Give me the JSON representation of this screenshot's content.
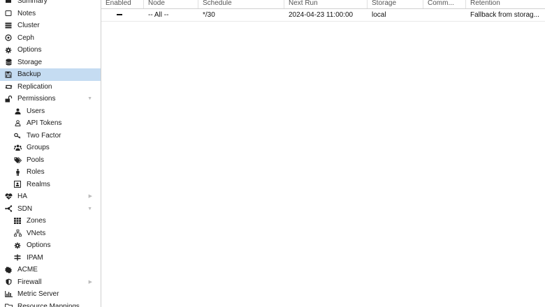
{
  "sidebar": {
    "items": [
      {
        "label": "Summary",
        "icon": "summary-icon",
        "level": 0
      },
      {
        "label": "Notes",
        "icon": "notes-icon",
        "level": 0
      },
      {
        "label": "Cluster",
        "icon": "server-icon",
        "level": 0
      },
      {
        "label": "Ceph",
        "icon": "ceph-icon",
        "level": 0
      },
      {
        "label": "Options",
        "icon": "gear-icon",
        "level": 0
      },
      {
        "label": "Storage",
        "icon": "database-icon",
        "level": 0
      },
      {
        "label": "Backup",
        "icon": "floppy-icon",
        "level": 0,
        "selected": true
      },
      {
        "label": "Replication",
        "icon": "retweet-icon",
        "level": 0
      },
      {
        "label": "Permissions",
        "icon": "unlock-icon",
        "level": 0,
        "caret": "down"
      },
      {
        "label": "Users",
        "icon": "user-icon",
        "level": 1
      },
      {
        "label": "API Tokens",
        "icon": "user-outline-icon",
        "level": 1
      },
      {
        "label": "Two Factor",
        "icon": "key-icon",
        "level": 1
      },
      {
        "label": "Groups",
        "icon": "users-icon",
        "level": 1
      },
      {
        "label": "Pools",
        "icon": "tags-icon",
        "level": 1
      },
      {
        "label": "Roles",
        "icon": "male-icon",
        "level": 1
      },
      {
        "label": "Realms",
        "icon": "address-book-icon",
        "level": 1
      },
      {
        "label": "HA",
        "icon": "heartbeat-icon",
        "level": 0,
        "caret": "right"
      },
      {
        "label": "SDN",
        "icon": "sdn-icon",
        "level": 0,
        "caret": "down"
      },
      {
        "label": "Zones",
        "icon": "th-icon",
        "level": 1
      },
      {
        "label": "VNets",
        "icon": "network-icon",
        "level": 1
      },
      {
        "label": "Options",
        "icon": "gear-icon",
        "level": 1
      },
      {
        "label": "IPAM",
        "icon": "ipam-icon",
        "level": 1
      },
      {
        "label": "ACME",
        "icon": "certificate-icon",
        "level": 0
      },
      {
        "label": "Firewall",
        "icon": "shield-icon",
        "level": 0,
        "caret": "right"
      },
      {
        "label": "Metric Server",
        "icon": "bar-chart-icon",
        "level": 0
      },
      {
        "label": "Resource Mappings",
        "icon": "folder-icon",
        "level": 0
      }
    ]
  },
  "grid": {
    "columns": [
      {
        "label": "Enabled"
      },
      {
        "label": "Node"
      },
      {
        "label": "Schedule"
      },
      {
        "label": "Next Run"
      },
      {
        "label": "Storage"
      },
      {
        "label": "Comm..."
      },
      {
        "label": "Retention"
      }
    ],
    "rows": [
      {
        "enabled": "",
        "node": "-- All --",
        "schedule": "*/30",
        "next_run": "2024-04-23 11:00:00",
        "storage": "local",
        "comment": "",
        "retention": "Fallback from storag..."
      }
    ]
  }
}
